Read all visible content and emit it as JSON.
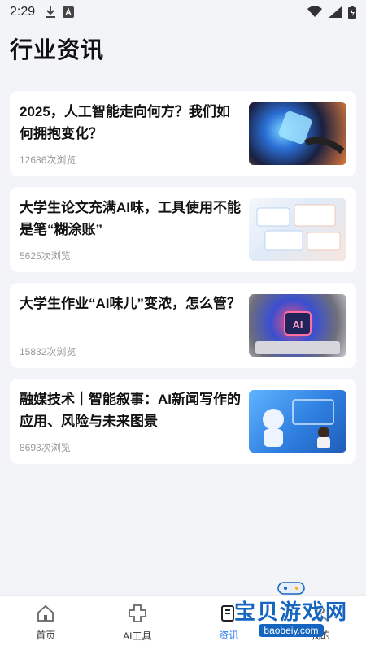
{
  "status_bar": {
    "time": "2:29",
    "icons": [
      "download-icon",
      "a-app-icon",
      "wifi-icon",
      "signal-icon",
      "battery-icon"
    ]
  },
  "page": {
    "title": "行业资讯"
  },
  "news": [
    {
      "title": "2025，人工智能走向何方？我们如何拥抱变化？",
      "views": "12686次浏览"
    },
    {
      "title": "大学生论文充满AI味，工具使用不能是笔“糊涂账”",
      "views": "5625次浏览"
    },
    {
      "title": "大学生作业“AI味儿”变浓，怎么管？",
      "views": "15832次浏览"
    },
    {
      "title": "融媒技术｜智能叙事：AI新闻写作的应用、风险与未来图景",
      "views": "8693次浏览"
    }
  ],
  "nav": {
    "home": "首页",
    "ai_tools": "AI工具",
    "news": "资讯",
    "mine": "我的"
  },
  "watermark": {
    "text": "宝贝游戏网",
    "url": "baobeiy.com"
  },
  "colors": {
    "accent": "#2a7bf6",
    "background": "#f3f4f8"
  }
}
